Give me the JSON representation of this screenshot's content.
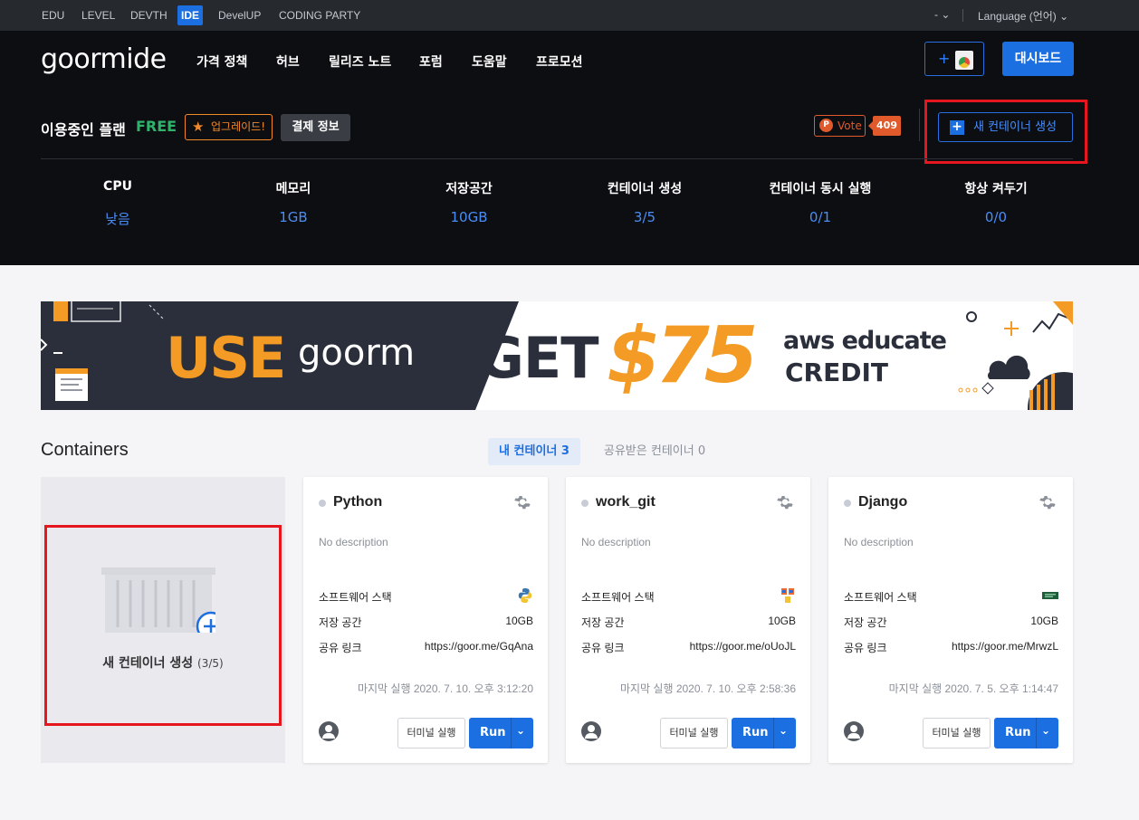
{
  "topbar": {
    "tabs": [
      "EDU",
      "LEVEL",
      "DEVTH",
      "IDE",
      "DevelUP",
      "CODING PARTY"
    ],
    "active_tab": "IDE",
    "mode_toggle": "-",
    "language": "Language (언어)"
  },
  "header": {
    "logo": "goormide",
    "nav": [
      "가격 정책",
      "허브",
      "릴리즈 노트",
      "포럼",
      "도움말",
      "프로모션"
    ],
    "add_button": "+",
    "dashboard_button": "대시보드"
  },
  "plan": {
    "label": "이용중인 플랜",
    "name": "FREE",
    "upgrade_label": "업그레이드!",
    "payment_label": "결제 정보",
    "vote_label": "Vote",
    "vote_count": "409",
    "new_container_label": "새 컨테이너 생성"
  },
  "stats": [
    {
      "label": "CPU",
      "value": "낮음"
    },
    {
      "label": "메모리",
      "value": "1GB"
    },
    {
      "label": "저장공간",
      "value": "10GB"
    },
    {
      "label": "컨테이너 생성",
      "value": "3/5"
    },
    {
      "label": "컨테이너 동시 실행",
      "value": "0/1"
    },
    {
      "label": "항상 켜두기",
      "value": "0/0"
    }
  ],
  "banner": {
    "use": "USE",
    "goorm": "goorm",
    "get": "GET",
    "amount": "$75",
    "aws": "aws educate",
    "credit": "CREDIT"
  },
  "containers": {
    "title": "Containers",
    "tab_mine": "내 컨테이너 3",
    "tab_shared": "공유받은 컨테이너 0",
    "new_card_label": "새 컨테이너 생성",
    "new_card_count": "(3/5)",
    "labels": {
      "stack": "소프트웨어 스택",
      "storage": "저장 공간",
      "share": "공유 링크",
      "terminal": "터미널 실행",
      "run": "Run"
    },
    "items": [
      {
        "name": "Python",
        "description": "No description",
        "stack_icon": "python-icon",
        "storage": "10GB",
        "share_link": "https://goor.me/GqAna",
        "last_run": "마지막 실행 2020. 7. 10. 오후 3:12:20"
      },
      {
        "name": "work_git",
        "description": "No description",
        "stack_icon": "git-icon",
        "storage": "10GB",
        "share_link": "https://goor.me/oUoJL",
        "last_run": "마지막 실행 2020. 7. 10. 오후 2:58:36"
      },
      {
        "name": "Django",
        "description": "No description",
        "stack_icon": "django-icon",
        "storage": "10GB",
        "share_link": "https://goor.me/MrwzL",
        "last_run": "마지막 실행 2020. 7. 5. 오후 1:14:47"
      }
    ]
  },
  "colors": {
    "accent": "#1c6fe0",
    "free": "#2fb36c",
    "upgrade": "#f08a2c",
    "vote": "#e05a2b",
    "highlight": "#e5161e"
  }
}
